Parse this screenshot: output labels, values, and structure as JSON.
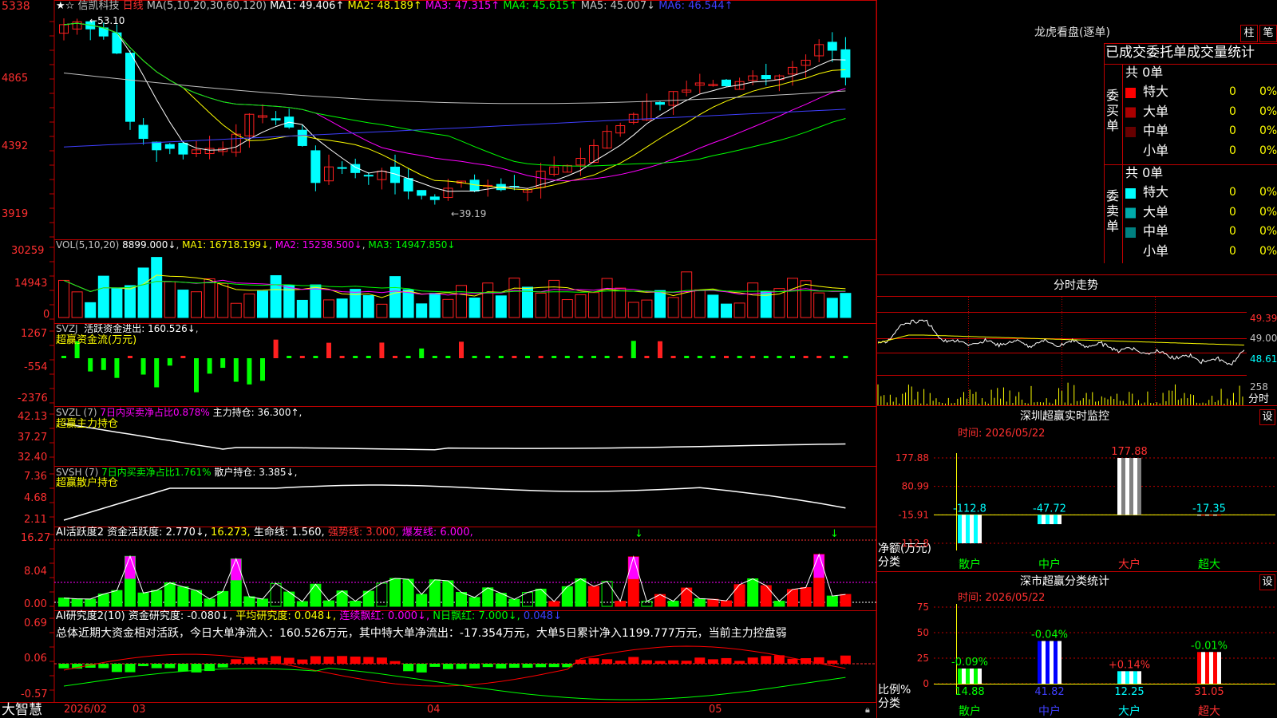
{
  "stock": {
    "name": "信凯科技",
    "period": "日线",
    "flags": "★☆",
    "price_axis": [
      "5338",
      "4865",
      "4392",
      "3919"
    ],
    "high_label": "53.10",
    "low_label": "39.19",
    "ma_header": {
      "params": "MA(5,10,20,30,60,120)",
      "items": [
        {
          "label": "MA1: 49.406↑",
          "color": "#ffffff"
        },
        {
          "label": "MA2: 48.189↑",
          "color": "#ffff00"
        },
        {
          "label": "MA3: 47.315↑",
          "color": "#ff00ff"
        },
        {
          "label": "MA4: 45.615↑",
          "color": "#00ff00"
        },
        {
          "label": "MA5: 45.007↓",
          "color": "#c0c0c0"
        },
        {
          "label": "MA6: 46.544↑",
          "color": "#3f3fff"
        }
      ]
    }
  },
  "volume_panel": {
    "params": "VOL(5,10,20)",
    "value": "8899.000↓",
    "ma": [
      {
        "label": "MA1: 16718.199↓",
        "color": "#ffff00"
      },
      {
        "label": "MA2: 15238.500↓",
        "color": "#ff00ff"
      },
      {
        "label": "MA3: 14947.850↓",
        "color": "#00ff00"
      }
    ],
    "axis": [
      "30259",
      "14943",
      "0"
    ]
  },
  "svzj_panel": {
    "name": "SVZJ",
    "line": "活跃资金进出: 160.526↓",
    "subtitle": "超赢资金流(万元)",
    "axis": [
      "1267",
      "-554",
      "-2376"
    ]
  },
  "svzl_panel": {
    "name": "SVZL (7)",
    "ratio": "7日内买卖净占比0.878%",
    "hold": "主力持仓: 36.300↑,",
    "subtitle": "超赢主力持仓",
    "axis": [
      "42.13",
      "37.27",
      "32.40"
    ]
  },
  "svsh_panel": {
    "name": "SVSH (7)",
    "ratio": "7日内买卖净占比1.761%",
    "hold": "散户持仓: 3.385↓,",
    "subtitle": "超赢散户持仓",
    "axis": [
      "7.36",
      "4.68",
      "2.11"
    ]
  },
  "ai_active_panel": {
    "name": "AI活跃度2",
    "label1": "资金活跃度: 2.770↓,",
    "label2": "16.273,",
    "label3": "生命线: 1.560,",
    "label4": "强势线: 3.000,",
    "label5": "爆发线: 6.000,",
    "axis": [
      "16.27",
      "8.04",
      "0.00"
    ]
  },
  "ai_research_panel": {
    "name": "AI研究度2(10)",
    "label1": "资金研究度: -0.080↓,",
    "label2": "平均研究度: 0.048↓,",
    "label3": "连续飘红: 0.000↓,",
    "label4": "N日飘红: 7.000↓,",
    "label5": "0.048↓",
    "summary": "总体近期大资金相对活跃，今日大单净流入：160.526万元，其中特大单净流出：-17.354万元，大单5日累计净入1199.777万元，当前主力控盘弱",
    "axis": [
      "0.69",
      "0.06",
      "-0.57"
    ]
  },
  "date_axis": {
    "brand": "大智慧",
    "labels": [
      "2026/02",
      "03",
      "04",
      "05"
    ]
  },
  "lhkp": {
    "title": "龙虎看盘(逐单)",
    "btn_bar": "柱",
    "btn_pen": "笔",
    "tabs": [
      "已成交",
      "委托单",
      "成交量统计"
    ],
    "buy": {
      "side": "委买单",
      "total": "共 0单",
      "rows": [
        {
          "name": "特大",
          "count": "0",
          "pct": "0%",
          "color": "#ff0000"
        },
        {
          "name": "大单",
          "count": "0",
          "pct": "0%",
          "color": "#aa0000"
        },
        {
          "name": "中单",
          "count": "0",
          "pct": "0%",
          "color": "#660000"
        },
        {
          "name": "小单",
          "count": "0",
          "pct": "0%",
          "color": ""
        }
      ]
    },
    "sell": {
      "side": "委卖单",
      "total": "共 0单",
      "rows": [
        {
          "name": "特大",
          "count": "0",
          "pct": "0%",
          "color": "#00ffff"
        },
        {
          "name": "大单",
          "count": "0",
          "pct": "0%",
          "color": "#00aaaa"
        },
        {
          "name": "中单",
          "count": "0",
          "pct": "0%",
          "color": "#008080"
        },
        {
          "name": "小单",
          "count": "0",
          "pct": "0%",
          "color": ""
        }
      ]
    }
  },
  "intraday": {
    "title": "分时走势",
    "price_labels": [
      "49.39",
      "49.00",
      "48.61"
    ],
    "vol_label": "258",
    "tag": "分时"
  },
  "monitor": {
    "title": "深圳超赢实时监控",
    "set": "设",
    "time": "时间: 2026/05/22",
    "axis": [
      "177.88",
      "80.99",
      "-15.91",
      "-112.8"
    ],
    "bars": [
      {
        "cat": "散户",
        "value": -112.8,
        "label": "-112.8"
      },
      {
        "cat": "中户",
        "value": -47.72,
        "label": "-47.72"
      },
      {
        "cat": "大户",
        "value": 177.88,
        "label": "177.88"
      },
      {
        "cat": "超大",
        "value": -17.35,
        "label": "-17.35"
      }
    ],
    "ylabel": "净额(万元)",
    "xlabel": "分类"
  },
  "stat": {
    "title": "深市超赢分类统计",
    "set": "设",
    "time": "时间: 2026/05/22",
    "axis": [
      "75",
      "50",
      "25",
      "0"
    ],
    "bars": [
      {
        "cat": "散户",
        "value": 14.88,
        "label": "14.88",
        "delta": "-0.09%"
      },
      {
        "cat": "中户",
        "value": 41.82,
        "label": "41.82",
        "delta": "-0.04%"
      },
      {
        "cat": "大户",
        "value": 12.25,
        "label": "12.25",
        "delta": "+0.14%"
      },
      {
        "cat": "超大",
        "value": 31.05,
        "label": "31.05",
        "delta": "-0.01%"
      }
    ],
    "ylabel": "比例%",
    "xlabel": "分类"
  },
  "colors": {
    "up": "#ff2020",
    "down": "#00ffff",
    "panel_border": "#c00000"
  }
}
